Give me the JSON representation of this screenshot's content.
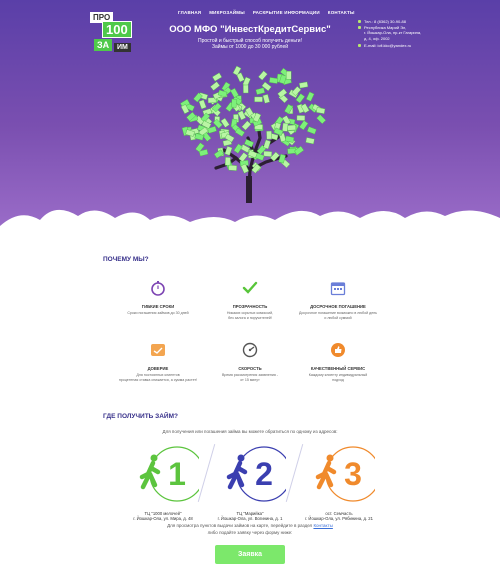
{
  "header": {
    "logo": {
      "top": "ПРО",
      "number": "100",
      "za": "ЗА",
      "word": "ИМ"
    },
    "nav": [
      "ГЛАВНАЯ",
      "МИКРОЗАЙМЫ",
      "РАСКРЫТИЕ ИНФОРМАЦИИ",
      "КОНТАКТЫ"
    ],
    "company_title": "ООО МФО \"ИнвестКредитСервис\"",
    "slogan": "Простой и быстрый способ получить деньги!",
    "amount": "Займы от 1000 до 30 000 рублей",
    "contacts": {
      "phone": "Тел.: 8 (8362) 30-90-88",
      "address1": "Республика Марий Эл,",
      "address2": "г. Йошкар-Ола, пр-кт Гагарина,",
      "address3": "д. 4, оф. 2002",
      "email": "E-mail: icfi.kkc@yandex.ru"
    }
  },
  "why": {
    "title": "ПОЧЕМУ МЫ?",
    "features": [
      {
        "icon": "stopwatch-icon",
        "title": "ГИБКИЕ СРОКИ",
        "desc1": "Сроки погашения займов до 30 дней",
        "desc2": ""
      },
      {
        "icon": "checkmark-icon",
        "title": "ПРОЗРАЧНОСТЬ",
        "desc1": "Никаких скрытых комиссий,",
        "desc2": "без залога и поручителей!"
      },
      {
        "icon": "calendar-icon",
        "title": "ДОСРОЧНОЕ ПОГАШЕНИЕ",
        "desc1": "Досрочное погашение возможно в любой день",
        "desc2": "и любой суммой"
      },
      {
        "icon": "handshake-icon",
        "title": "ДОВЕРИЕ",
        "desc1": "Для постоянных клиентов",
        "desc2": "процентная ставка снижается, а сумма растет!"
      },
      {
        "icon": "speedometer-icon",
        "title": "СКОРОСТЬ",
        "desc1": "Время рассмотрения заявления -",
        "desc2": "от 15 минут"
      },
      {
        "icon": "thumbs-up-icon",
        "title": "КАЧЕСТВЕННЫЙ СЕРВИС",
        "desc1": "Каждому клиенту индивидуальный",
        "desc2": "подход"
      }
    ]
  },
  "where": {
    "title": "ГДЕ ПОЛУЧИТЬ ЗАЙМ?",
    "subtitle": "Для получения или погашения займа вы можете обратиться по одному из адресов:",
    "points": [
      {
        "num": "1",
        "color": "#5cc43e",
        "name": "ТЦ \"1000 мелочей\"",
        "address": "г. Йошкар-Ола, ул. Мира, д. 48"
      },
      {
        "num": "2",
        "color": "#3b3fb0",
        "name": "ТЦ \"Марийка\"",
        "address": "г. Йошкар-Ола, ул. Вогинина, д. 1"
      },
      {
        "num": "3",
        "color": "#f08a2c",
        "name": "ост. Семчасть",
        "address": "г. Йошкар-Ола, ул. Рябинина, д. 21"
      }
    ],
    "note1": "Для просмотра пунктов выдачи займов на карте, перейдите в раздел",
    "note_link": "Контакты",
    "note2": "либо подайте заявку через форму ниже:",
    "cta": "Заявка"
  }
}
